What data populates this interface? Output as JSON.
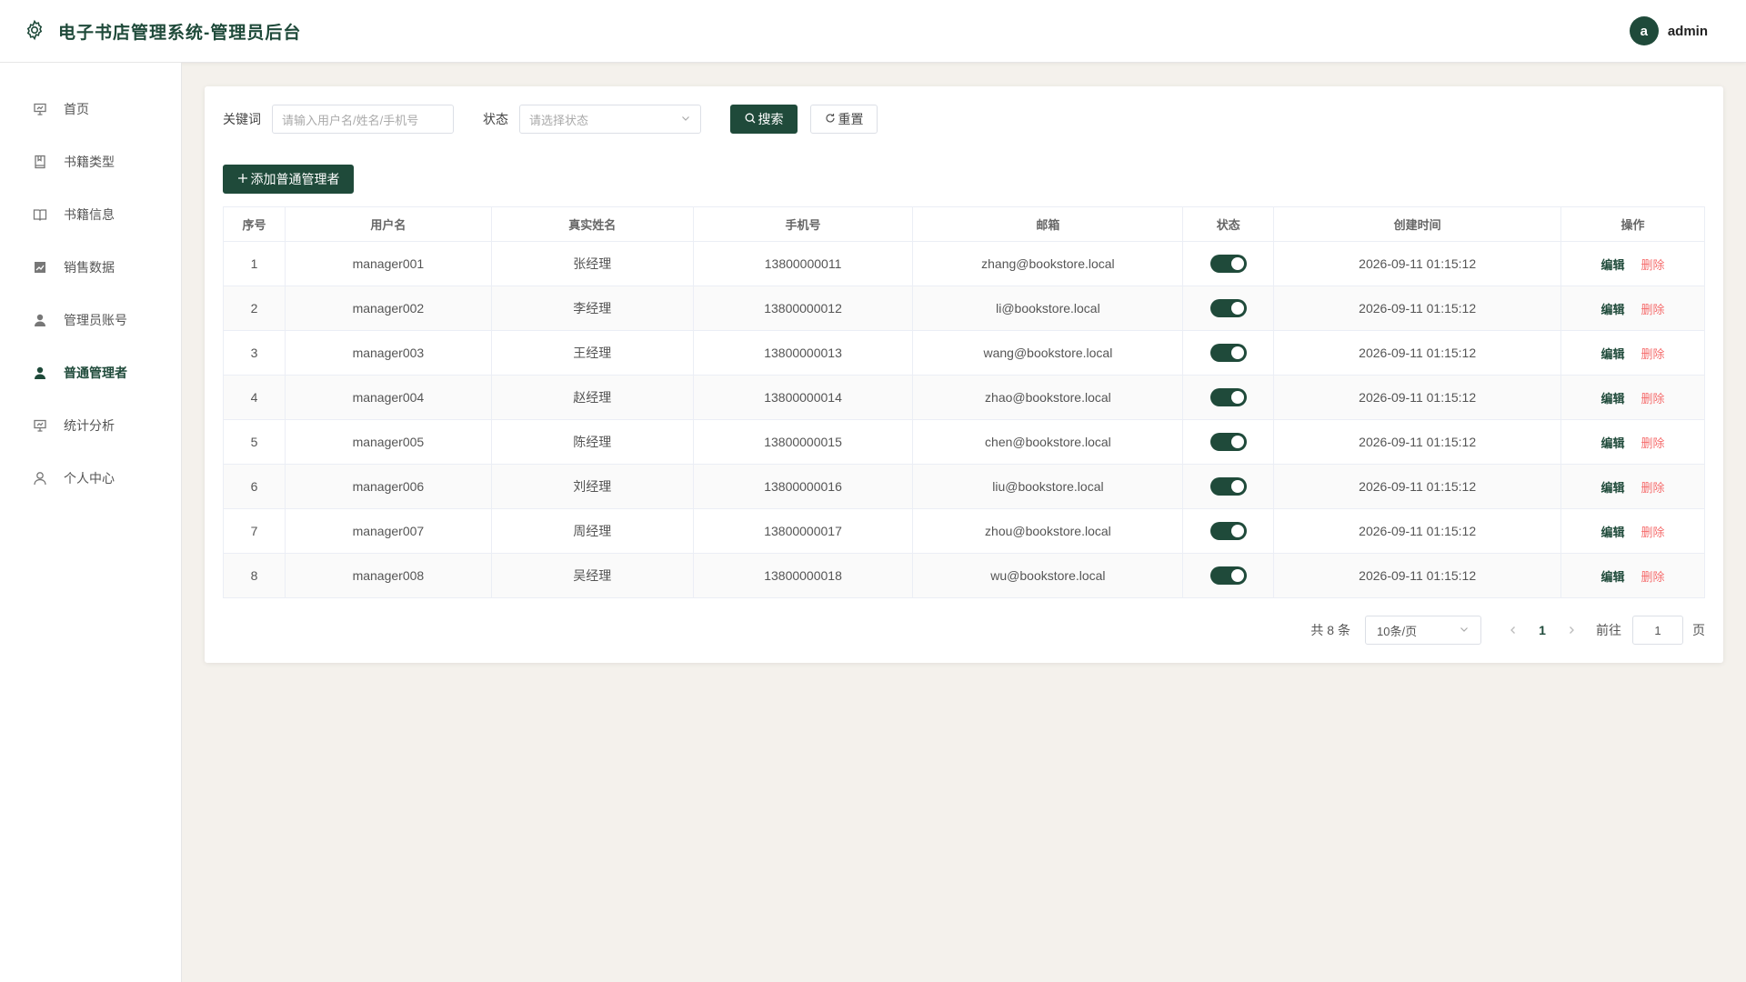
{
  "header": {
    "title": "电子书店管理系统-管理员后台",
    "avatar_letter": "a",
    "username": "admin"
  },
  "sidebar": {
    "items": [
      {
        "label": "首页",
        "icon": "presentation-icon"
      },
      {
        "label": "书籍类型",
        "icon": "book-icon"
      },
      {
        "label": "书籍信息",
        "icon": "open-book-icon"
      },
      {
        "label": "销售数据",
        "icon": "chart-icon"
      },
      {
        "label": "管理员账号",
        "icon": "user-filled-icon"
      },
      {
        "label": "普通管理者",
        "icon": "user-filled-icon",
        "active": true
      },
      {
        "label": "统计分析",
        "icon": "presentation-icon"
      },
      {
        "label": "个人中心",
        "icon": "user-outline-icon"
      }
    ]
  },
  "filters": {
    "keyword_label": "关键词",
    "keyword_placeholder": "请输入用户名/姓名/手机号",
    "status_label": "状态",
    "status_placeholder": "请选择状态",
    "search_label": "搜索",
    "reset_label": "重置"
  },
  "toolbar": {
    "add_label": "添加普通管理者"
  },
  "table": {
    "headers": [
      "序号",
      "用户名",
      "真实姓名",
      "手机号",
      "邮箱",
      "状态",
      "创建时间",
      "操作"
    ],
    "edit_label": "编辑",
    "delete_label": "删除",
    "rows": [
      {
        "no": "1",
        "username": "manager001",
        "name": "张经理",
        "phone": "13800000011",
        "email": "zhang@bookstore.local",
        "enabled": true,
        "created": "2026-09-11 01:15:12"
      },
      {
        "no": "2",
        "username": "manager002",
        "name": "李经理",
        "phone": "13800000012",
        "email": "li@bookstore.local",
        "enabled": true,
        "created": "2026-09-11 01:15:12"
      },
      {
        "no": "3",
        "username": "manager003",
        "name": "王经理",
        "phone": "13800000013",
        "email": "wang@bookstore.local",
        "enabled": true,
        "created": "2026-09-11 01:15:12"
      },
      {
        "no": "4",
        "username": "manager004",
        "name": "赵经理",
        "phone": "13800000014",
        "email": "zhao@bookstore.local",
        "enabled": true,
        "created": "2026-09-11 01:15:12"
      },
      {
        "no": "5",
        "username": "manager005",
        "name": "陈经理",
        "phone": "13800000015",
        "email": "chen@bookstore.local",
        "enabled": true,
        "created": "2026-09-11 01:15:12"
      },
      {
        "no": "6",
        "username": "manager006",
        "name": "刘经理",
        "phone": "13800000016",
        "email": "liu@bookstore.local",
        "enabled": true,
        "created": "2026-09-11 01:15:12"
      },
      {
        "no": "7",
        "username": "manager007",
        "name": "周经理",
        "phone": "13800000017",
        "email": "zhou@bookstore.local",
        "enabled": true,
        "created": "2026-09-11 01:15:12"
      },
      {
        "no": "8",
        "username": "manager008",
        "name": "吴经理",
        "phone": "13800000018",
        "email": "wu@bookstore.local",
        "enabled": true,
        "created": "2026-09-11 01:15:12"
      }
    ]
  },
  "pagination": {
    "total_text": "共 8 条",
    "page_size": "10条/页",
    "current_page": "1",
    "goto_label": "前往",
    "goto_value": "1",
    "page_suffix": "页"
  },
  "colors": {
    "primary": "#1f4a3a",
    "danger": "#f56c6c",
    "background": "#f4f1ec"
  }
}
